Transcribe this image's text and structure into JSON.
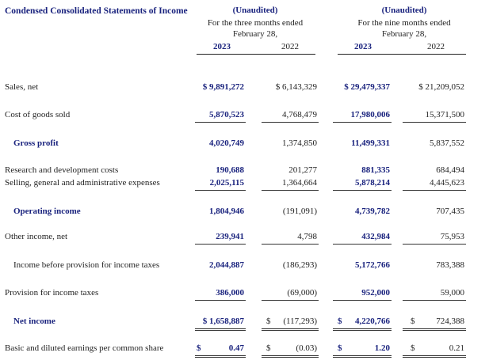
{
  "title": "Condensed Consolidated Statements of Income",
  "headers": {
    "three_months": {
      "unaudited": "(Unaudited)",
      "line1": "For the three months ended",
      "line2": "February 28,",
      "year_current": "2023",
      "year_prior": "2022"
    },
    "nine_months": {
      "unaudited": "(Unaudited)",
      "line1": "For the nine months ended",
      "line2": "February 28,",
      "year_current": "2023",
      "year_prior": "2022"
    }
  },
  "rows": [
    {
      "label": "Sales, net",
      "q3_2023": "$ 9,891,272",
      "q3_2022": "$  6,143,329",
      "nine_2023": "$ 29,479,337",
      "nine_2022": "$  21,209,052"
    },
    {
      "label": "Cost of goods sold",
      "q3_2023": "5,870,523",
      "q3_2022": "4,768,479",
      "nine_2023": "17,980,006",
      "nine_2022": "15,371,500"
    },
    {
      "label": "Gross profit",
      "q3_2023": "4,020,749",
      "q3_2022": "1,374,850",
      "nine_2023": "11,499,331",
      "nine_2022": "5,837,552"
    },
    {
      "label": "Research and development costs",
      "q3_2023": "190,688",
      "q3_2022": "201,277",
      "nine_2023": "881,335",
      "nine_2022": "684,494"
    },
    {
      "label": "Selling, general and administrative expenses",
      "q3_2023": "2,025,115",
      "q3_2022": "1,364,664",
      "nine_2023": "5,878,214",
      "nine_2022": "4,445,623"
    },
    {
      "label": "Operating income",
      "q3_2023": "1,804,946",
      "q3_2022": "(191,091)",
      "nine_2023": "4,739,782",
      "nine_2022": "707,435"
    },
    {
      "label": "Other income, net",
      "q3_2023": "239,941",
      "q3_2022": "4,798",
      "nine_2023": "432,984",
      "nine_2022": "75,953"
    },
    {
      "label": "Income before provision for income taxes",
      "q3_2023": "2,044,887",
      "q3_2022": "(186,293)",
      "nine_2023": "5,172,766",
      "nine_2022": "783,388"
    },
    {
      "label": "Provision for income taxes",
      "q3_2023": "386,000",
      "q3_2022": "(69,000)",
      "nine_2023": "952,000",
      "nine_2022": "59,000"
    },
    {
      "label": "Net income",
      "q3_2023": "$ 1,658,887",
      "q3_2022": "(117,293)",
      "nine_2023": "4,220,766",
      "nine_2022": "724,388"
    },
    {
      "label": "Basic and diluted earnings per common share",
      "q3_2023": "0.47",
      "q3_2022": "(0.03)",
      "nine_2023": "1.20",
      "nine_2022": "0.21"
    }
  ],
  "currency_symbol": "$"
}
